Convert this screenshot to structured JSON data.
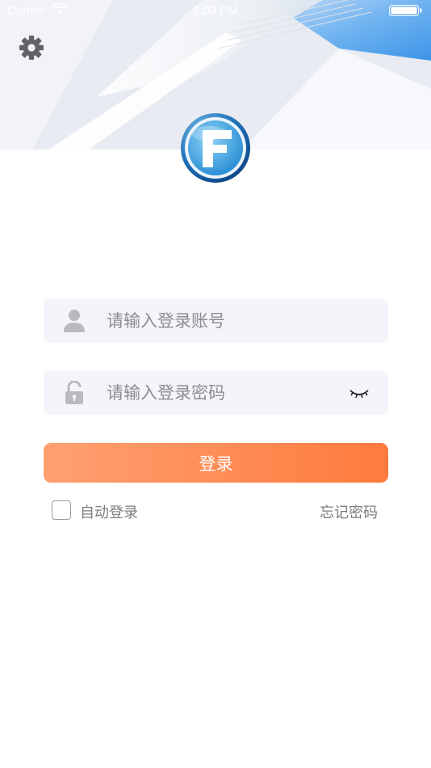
{
  "status_bar": {
    "carrier": "Carrier",
    "time": "9:09 PM"
  },
  "header": {
    "settings_icon": "gear-icon",
    "logo_icon": "app-logo-icon"
  },
  "login_form": {
    "account": {
      "icon": "user-icon",
      "value": "",
      "placeholder": "请输入登录账号"
    },
    "password": {
      "icon": "lock-icon",
      "value": "",
      "placeholder": "请输入登录密码",
      "toggle_icon": "eye-closed-icon"
    },
    "login_button_label": "登录",
    "auto_login": {
      "label": "自动登录",
      "checked": false
    },
    "forgot_password_label": "忘记密码"
  },
  "colors": {
    "button_start": "#ffa071",
    "button_end": "#ff7a3d",
    "field_bg": "#f4f5fb",
    "placeholder": "#8c8c92",
    "link_text": "#7b7b80"
  }
}
